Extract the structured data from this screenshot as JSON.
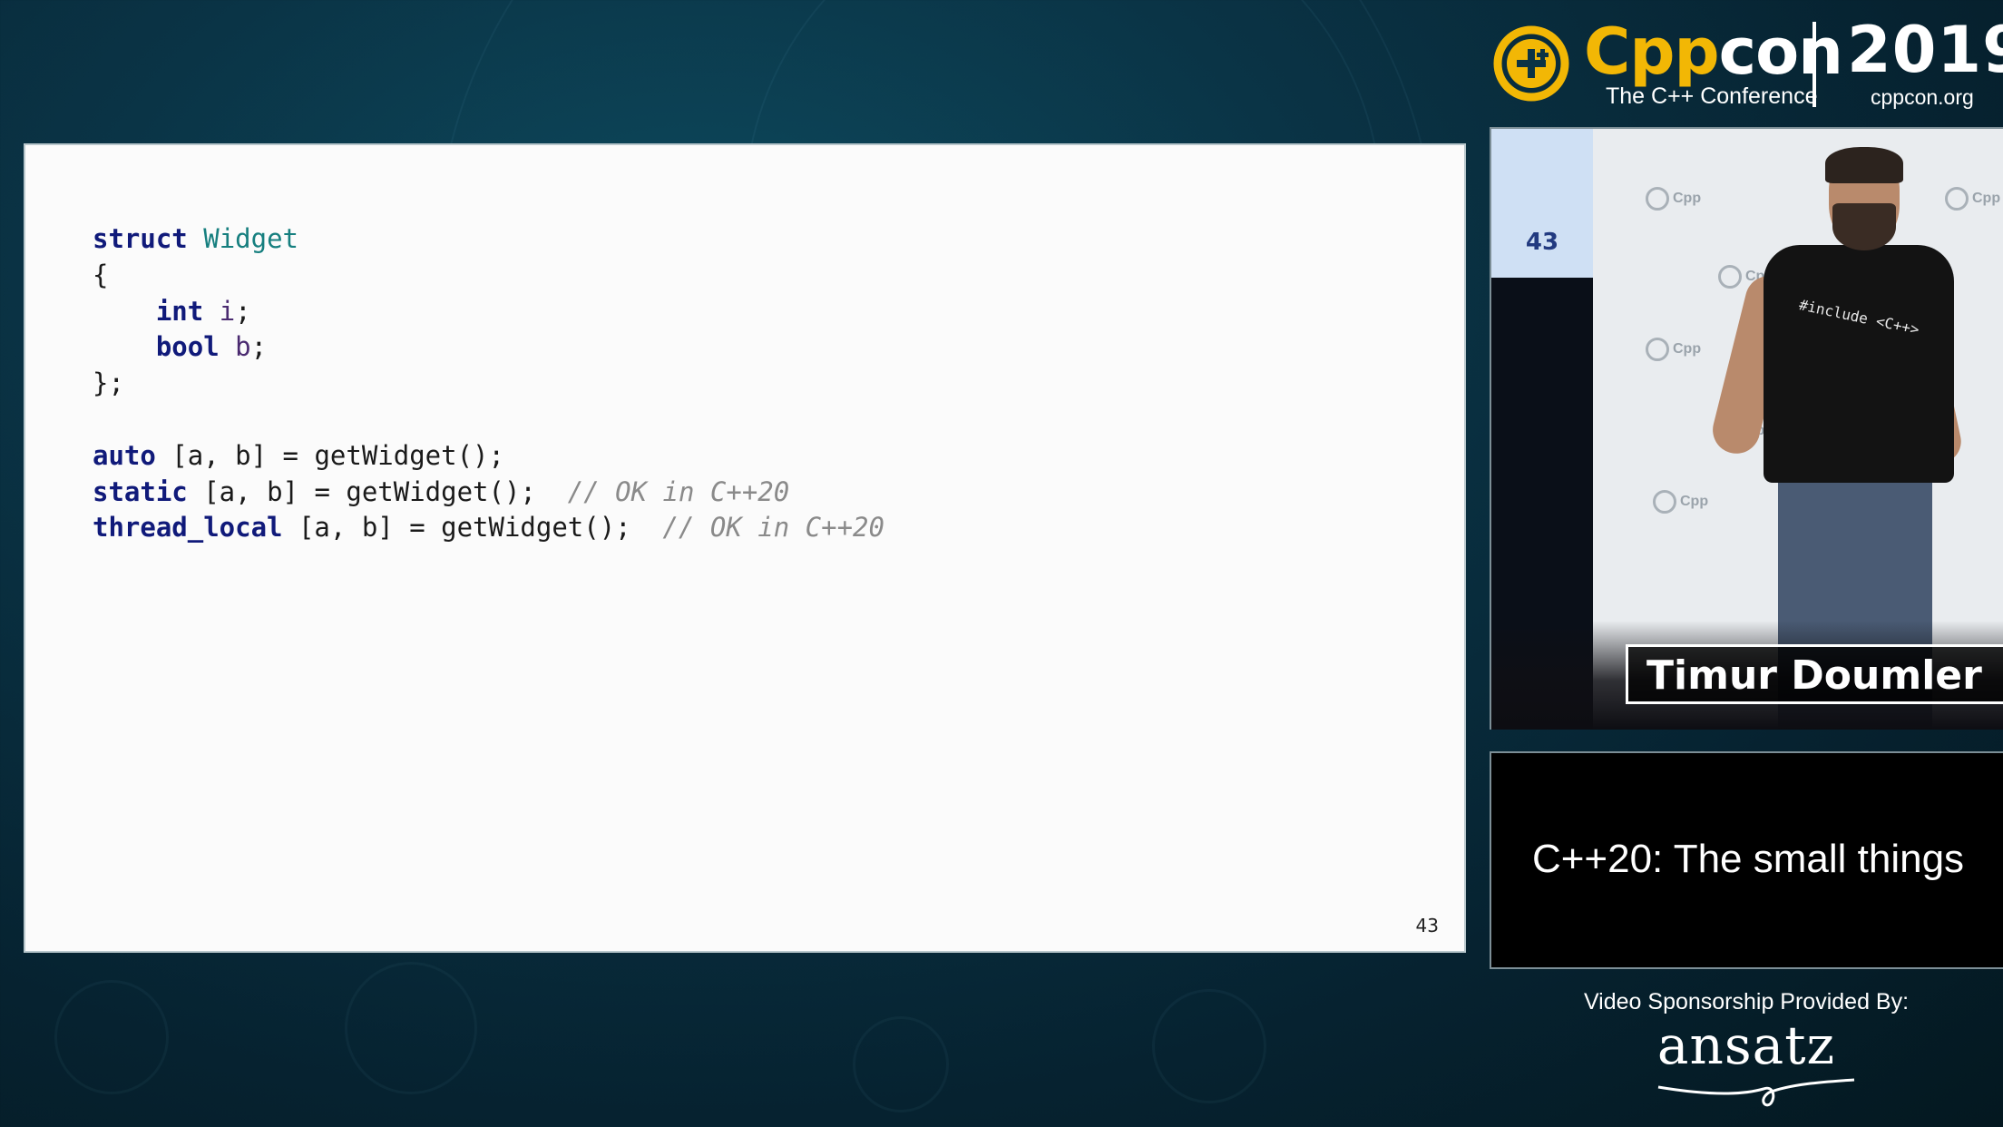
{
  "branding": {
    "logo_name_prefix": "Cpp",
    "logo_name_suffix": "con",
    "logo_tagline": "The C++ Conference",
    "year": "2019",
    "url": "cppcon.org"
  },
  "slide": {
    "code_lines": [
      [
        {
          "t": "struct",
          "c": "kw"
        },
        {
          "t": " ",
          "c": ""
        },
        {
          "t": "Widget",
          "c": "ty"
        }
      ],
      [
        {
          "t": "{",
          "c": ""
        }
      ],
      [
        {
          "t": "    ",
          "c": ""
        },
        {
          "t": "int",
          "c": "kw"
        },
        {
          "t": " ",
          "c": ""
        },
        {
          "t": "i",
          "c": "va"
        },
        {
          "t": ";",
          "c": ""
        }
      ],
      [
        {
          "t": "    ",
          "c": ""
        },
        {
          "t": "bool",
          "c": "kw"
        },
        {
          "t": " ",
          "c": ""
        },
        {
          "t": "b",
          "c": "va"
        },
        {
          "t": ";",
          "c": ""
        }
      ],
      [
        {
          "t": "};",
          "c": ""
        }
      ],
      [
        {
          "t": "",
          "c": ""
        }
      ],
      [
        {
          "t": "auto",
          "c": "kw"
        },
        {
          "t": " [a, b] = getWidget();",
          "c": ""
        }
      ],
      [
        {
          "t": "static",
          "c": "kw"
        },
        {
          "t": " [a, b] = getWidget();  ",
          "c": ""
        },
        {
          "t": "// OK in C++20",
          "c": "cm"
        }
      ],
      [
        {
          "t": "thread_local",
          "c": "kw"
        },
        {
          "t": " [a, b] = getWidget();  ",
          "c": ""
        },
        {
          "t": "// OK in C++20",
          "c": "cm"
        }
      ]
    ],
    "page_number": "43"
  },
  "video": {
    "side_screen_number": "43",
    "shirt_text": "#include <C++>",
    "backdrop_logo_text": "Cpp",
    "speaker_name": "Timur Doumler"
  },
  "talk": {
    "title": "C++20: The small things"
  },
  "sponsor": {
    "label": "Video Sponsorship Provided By:",
    "brand": "ansatz"
  },
  "colors": {
    "accent": "#f2b705",
    "keyword": "#101a7a",
    "type": "#167f7f",
    "comment": "#8a8a8a"
  }
}
